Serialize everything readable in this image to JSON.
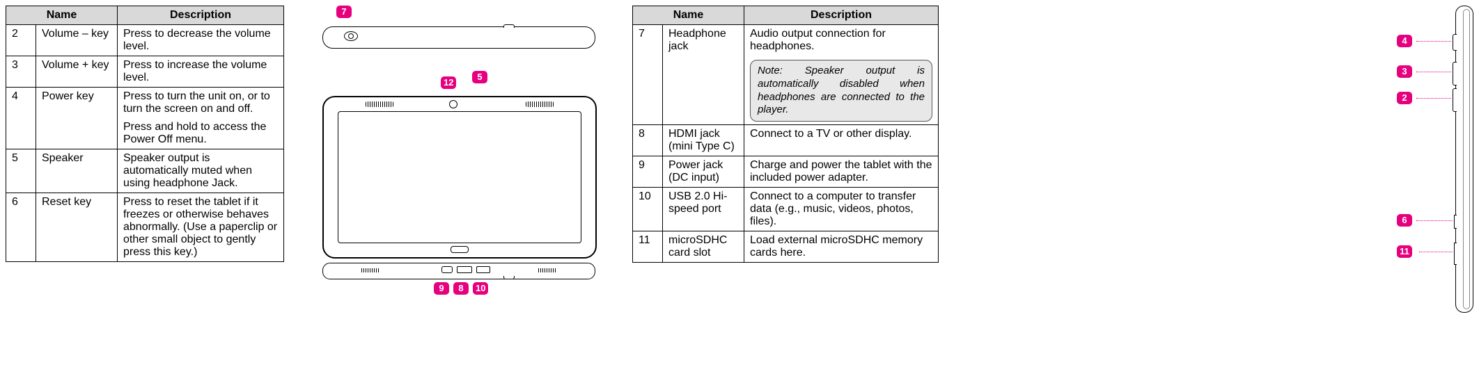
{
  "headers": {
    "name": "Name",
    "desc": "Description"
  },
  "left_table": [
    {
      "num": "2",
      "name": "Volume – key",
      "desc": "Press to decrease the volume level."
    },
    {
      "num": "3",
      "name": "Volume + key",
      "desc": "Press to increase the volume level."
    },
    {
      "num": "4",
      "name": "Power key",
      "desc": "Press to turn the unit on, or to turn the screen on and off.",
      "desc2": "Press and hold to access the Power Off menu."
    },
    {
      "num": "5",
      "name": "Speaker",
      "desc": "Speaker output is automatically muted when using headphone Jack."
    },
    {
      "num": "6",
      "name": "Reset key",
      "desc": "Press to reset the tablet if it freezes or otherwise behaves abnormally. (Use a paperclip or other small object to gently press this key.)"
    }
  ],
  "right_table": [
    {
      "num": "7",
      "name": "Headphone jack",
      "desc": "Audio output connection for headphones.",
      "note": "Note: Speaker output is automatically disabled when headphones are connected to the player."
    },
    {
      "num": "8",
      "name": "HDMI jack (mini Type C)",
      "desc": "Connect to a TV or other display."
    },
    {
      "num": "9",
      "name": "Power jack (DC input)",
      "desc": "Charge and power the tablet with the included power adapter."
    },
    {
      "num": "10",
      "name": "USB 2.0 Hi-speed port",
      "desc": "Connect to a computer to transfer data (e.g., music, videos, photos, files)."
    },
    {
      "num": "11",
      "name": "microSDHC card slot",
      "desc": "Load external microSDHC memory cards here."
    }
  ],
  "callouts": {
    "c7": "7",
    "c12": "12",
    "c5": "5",
    "c9": "9",
    "c8": "8",
    "c10": "10",
    "c4": "4",
    "c3": "3",
    "c2": "2",
    "c6": "6",
    "c11": "11"
  }
}
